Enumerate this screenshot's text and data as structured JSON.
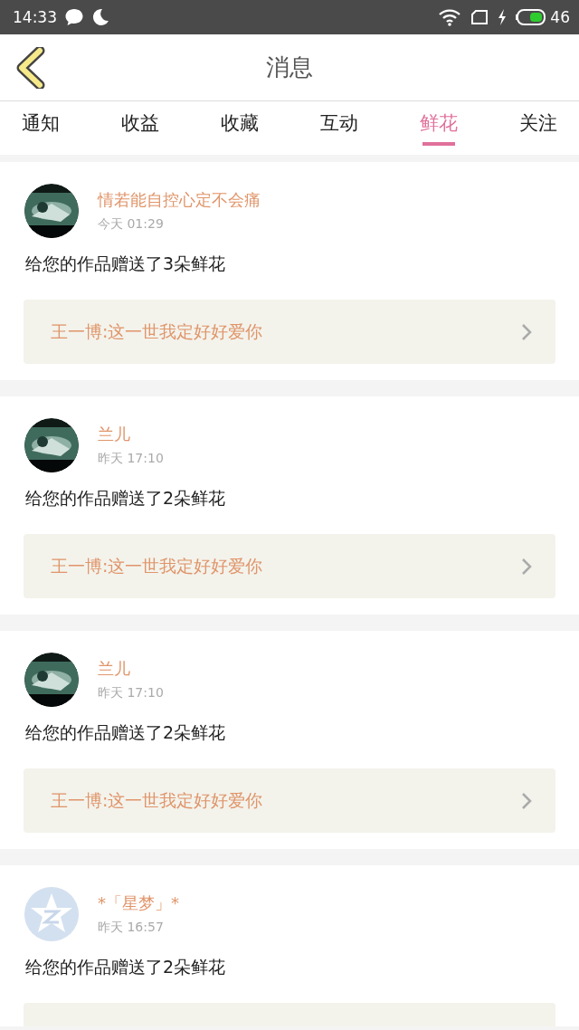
{
  "status_bar": {
    "time": "14:33",
    "battery": "46"
  },
  "header": {
    "title": "消息"
  },
  "tabs": [
    {
      "label": "通知",
      "selected": false
    },
    {
      "label": "收益",
      "selected": false
    },
    {
      "label": "收藏",
      "selected": false
    },
    {
      "label": "互动",
      "selected": false
    },
    {
      "label": "鲜花",
      "selected": true
    },
    {
      "label": "关注",
      "selected": false
    }
  ],
  "messages": [
    {
      "kind": "picture",
      "name": "情若能自控心定不会痛",
      "time": "今天 01:29",
      "text": "给您的作品赠送了3朵鲜花",
      "work": "王一博:这一世我定好好爱你"
    },
    {
      "kind": "picture",
      "name": "兰儿",
      "time": "昨天 17:10",
      "text": "给您的作品赠送了2朵鲜花",
      "work": "王一博:这一世我定好好爱你"
    },
    {
      "kind": "picture",
      "name": "兰儿",
      "time": "昨天 17:10",
      "text": "给您的作品赠送了2朵鲜花",
      "work": "王一博:这一世我定好好爱你"
    },
    {
      "kind": "default",
      "name": "*「星梦」*",
      "time": "昨天 16:57",
      "text": "给您的作品赠送了2朵鲜花",
      "work_cut": true
    }
  ]
}
